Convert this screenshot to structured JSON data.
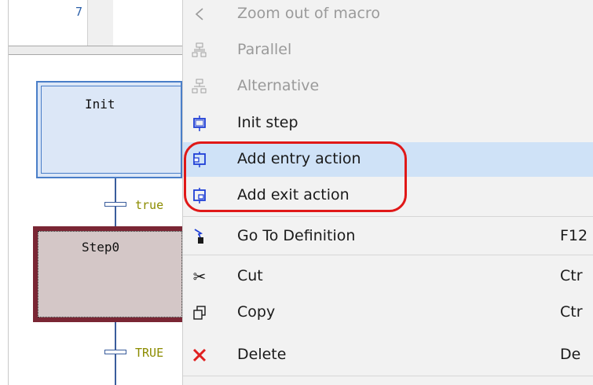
{
  "editor": {
    "line_number": "7",
    "steps": [
      {
        "label": "Init"
      },
      {
        "label": "Step0"
      }
    ],
    "transitions": [
      {
        "label": "true"
      },
      {
        "label": "TRUE"
      }
    ]
  },
  "context_menu": {
    "items": [
      {
        "label": "Zoom out of macro",
        "icon": "zoom-out-macro-icon",
        "enabled": false
      },
      {
        "label": "Parallel",
        "icon": "parallel-icon",
        "enabled": false
      },
      {
        "label": "Alternative",
        "icon": "alternative-icon",
        "enabled": false
      },
      {
        "label": "Init step",
        "icon": "init-step-icon",
        "enabled": true
      },
      {
        "label": "Add entry action",
        "icon": "add-entry-action-icon",
        "enabled": true,
        "highlighted": true
      },
      {
        "label": "Add exit action",
        "icon": "add-exit-action-icon",
        "enabled": true
      },
      {
        "label": "Go To Definition",
        "icon": "go-to-definition-icon",
        "enabled": true,
        "shortcut": "F12"
      },
      {
        "label": "Cut",
        "icon": "cut-icon",
        "enabled": true,
        "shortcut": "Ctr"
      },
      {
        "label": "Copy",
        "icon": "copy-icon",
        "enabled": true,
        "shortcut": "Ctr"
      },
      {
        "label": "Delete",
        "icon": "delete-icon",
        "enabled": true,
        "shortcut": "De"
      }
    ]
  },
  "colors": {
    "highlight": "#cfe2f7",
    "annotation": "#e01818",
    "icon_blue": "#1f3fd6",
    "delete_red": "#e02020"
  }
}
